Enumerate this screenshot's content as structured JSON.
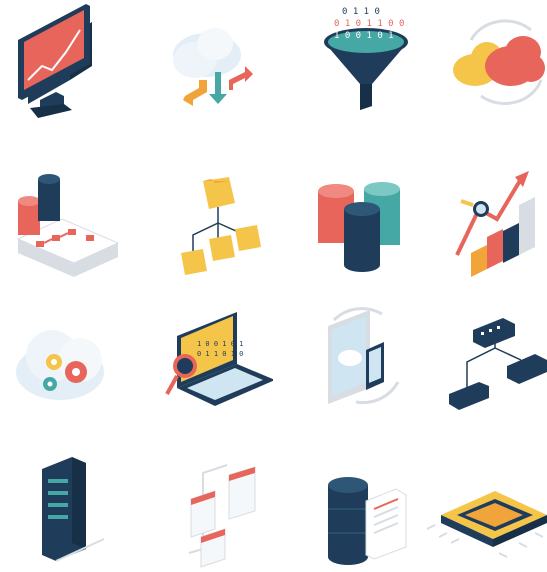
{
  "palette": {
    "navy": "#1f3d5a",
    "dark_navy": "#173047",
    "coral": "#e8655b",
    "red": "#d9473f",
    "teal": "#45a8a4",
    "yellow": "#f5c54a",
    "orange": "#f0a43a",
    "light_blue": "#cfe6f2",
    "gray": "#d7dde2",
    "white": "#ffffff"
  },
  "icons": [
    {
      "name": "monitor-chart-icon"
    },
    {
      "name": "cloud-transfer-icon"
    },
    {
      "name": "data-funnel-icon"
    },
    {
      "name": "cloud-sync-icon"
    },
    {
      "name": "database-flowchart-icon"
    },
    {
      "name": "folder-hierarchy-icon"
    },
    {
      "name": "database-stack-icon"
    },
    {
      "name": "growth-bar-chart-icon"
    },
    {
      "name": "cloud-settings-icon"
    },
    {
      "name": "laptop-binary-search-icon"
    },
    {
      "name": "tablet-phone-cloud-sync-icon"
    },
    {
      "name": "network-switch-icon"
    },
    {
      "name": "server-rack-icon"
    },
    {
      "name": "spreadsheet-hierarchy-icon"
    },
    {
      "name": "database-document-icon"
    },
    {
      "name": "processor-chip-icon"
    }
  ],
  "binary_digits": "0 1 0 1 1 0 0 1"
}
